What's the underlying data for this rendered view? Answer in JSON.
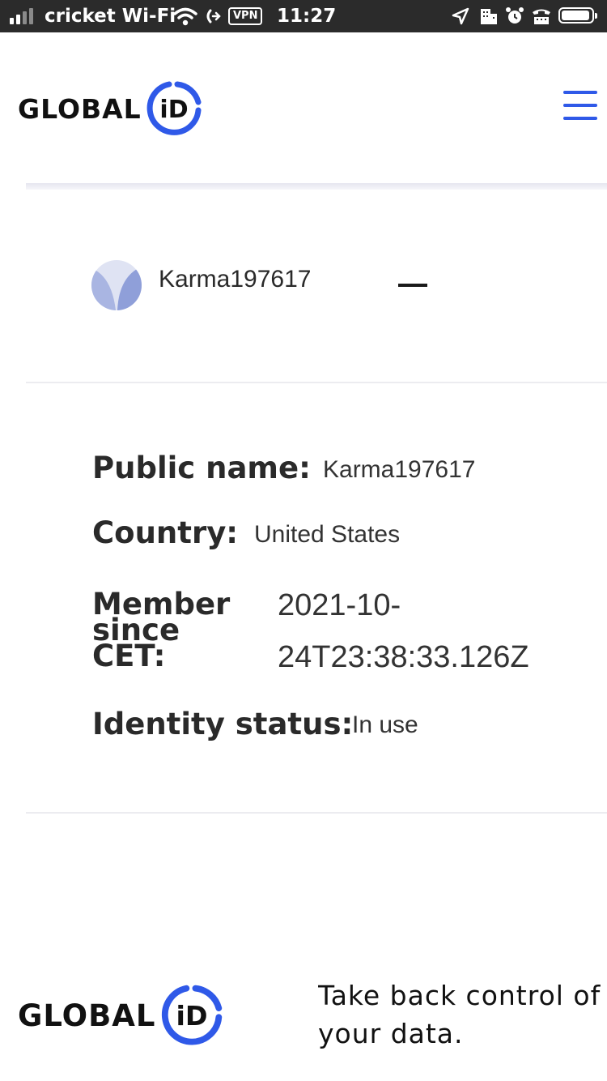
{
  "status_bar": {
    "carrier": "cricket Wi-Fi",
    "vpn": "VPN",
    "time": "11:27"
  },
  "brand": {
    "logo_word": "GLOBAL",
    "logo_mark": "iD",
    "accent_color": "#2f59e8"
  },
  "profile": {
    "username": "Karma197617"
  },
  "details": {
    "public_name_label": "Public name:",
    "public_name_value": "Karma197617",
    "country_label": "Country:",
    "country_value": "United States",
    "member_since_label_line1": "Member",
    "member_since_label_line2": "since",
    "member_since_label_line3": "CET:",
    "member_since_value_line1": "2021-10-",
    "member_since_value_line2": "24T23:38:33.126Z",
    "identity_status_label": "Identity status:",
    "identity_status_value": "In use"
  },
  "footer": {
    "tagline_line1": "Take back control of",
    "tagline_line2": "your data."
  },
  "icons": [
    "wifi-icon",
    "call-forward-icon",
    "location-arrow-icon",
    "building-icon",
    "alarm-icon",
    "tty-icon",
    "battery-icon",
    "menu-icon",
    "avatar-icon",
    "collapse-icon"
  ]
}
